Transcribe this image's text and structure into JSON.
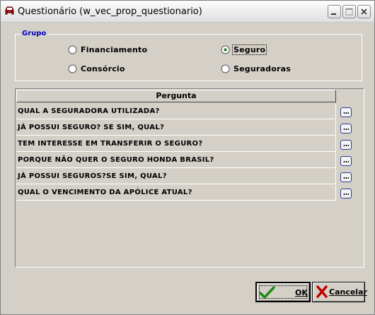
{
  "window": {
    "title": "Questionário  (w_vec_prop_questionario)",
    "title_icon": "car-front-icon"
  },
  "grupo": {
    "label": "Grupo",
    "options": [
      {
        "label": "Financiamento",
        "selected": false
      },
      {
        "label": "Seguro",
        "selected": true
      },
      {
        "label": "Consórcio",
        "selected": false
      },
      {
        "label": "Seguradoras",
        "selected": false
      }
    ]
  },
  "grid": {
    "header": "Pergunta",
    "rows": [
      {
        "pergunta": "QUAL A SEGURADORA UTILIZADA?",
        "button": "..."
      },
      {
        "pergunta": "JÁ POSSUI SEGURO? SE SIM, QUAL?",
        "button": "..."
      },
      {
        "pergunta": "TEM INTERESSE EM TRANSFERIR O SEGURO?",
        "button": "..."
      },
      {
        "pergunta": "PORQUE NÃO QUER O SEGURO HONDA BRASIL?",
        "button": "..."
      },
      {
        "pergunta": "JÁ POSSUI SEGUROS?SE SIM, QUAL?",
        "button": "..."
      },
      {
        "pergunta": "QUAL O VENCIMENTO DA APÓLICE ATUAL?",
        "button": "..."
      }
    ]
  },
  "buttons": {
    "ok_label": "OK",
    "cancel_label": "Cancelar"
  },
  "colors": {
    "face": "#d4d0c8",
    "group_label": "#0000c0",
    "ok_check": "#1a8a1a",
    "cancel_x": "#c00000"
  }
}
